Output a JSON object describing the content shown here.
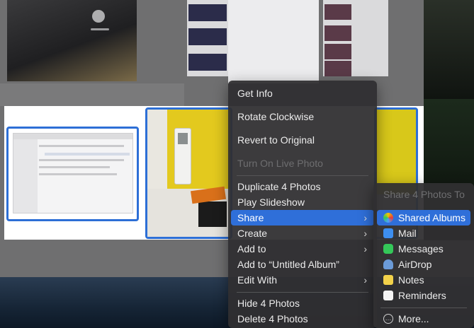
{
  "context_menu": {
    "items": [
      {
        "label": "Get Info",
        "disabled": false
      },
      {
        "label": "Rotate Clockwise",
        "disabled": false
      },
      {
        "label": "Revert to Original",
        "disabled": false
      },
      {
        "label": "Turn On Live Photo",
        "disabled": true
      },
      {
        "label": "Duplicate 4 Photos",
        "disabled": false
      },
      {
        "label": "Play Slideshow",
        "disabled": false
      },
      {
        "label": "Share",
        "disabled": false,
        "submenu": true,
        "highlighted": true
      },
      {
        "label": "Create",
        "disabled": false,
        "submenu": true
      },
      {
        "label": "Add to",
        "disabled": false,
        "submenu": true
      },
      {
        "label": "Add to “Untitled Album”",
        "disabled": false
      },
      {
        "label": "Edit With",
        "disabled": false,
        "submenu": true
      },
      {
        "label": "Hide 4 Photos",
        "disabled": false
      },
      {
        "label": "Delete 4 Photos",
        "disabled": false
      }
    ],
    "chevron": "›"
  },
  "share_submenu": {
    "header": "Share 4 Photos To",
    "items": [
      {
        "label": "Shared Albums",
        "icon": "shared-albums-icon",
        "highlighted": true
      },
      {
        "label": "Mail",
        "icon": "mail-icon"
      },
      {
        "label": "Messages",
        "icon": "messages-icon"
      },
      {
        "label": "AirDrop",
        "icon": "airdrop-icon"
      },
      {
        "label": "Notes",
        "icon": "notes-icon"
      },
      {
        "label": "Reminders",
        "icon": "reminders-icon"
      },
      {
        "label": "More...",
        "icon": "more-icon"
      }
    ]
  },
  "colors": {
    "selection": "#2d6fd6",
    "menu_bg": "#302f31",
    "highlight": "#2f6fd9"
  }
}
